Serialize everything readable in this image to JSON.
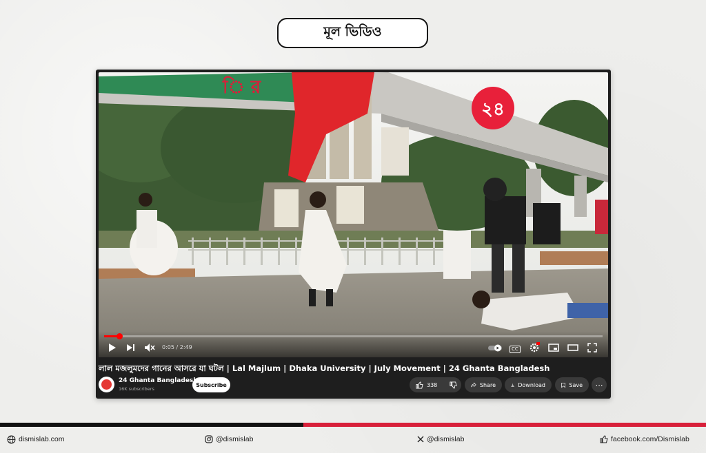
{
  "header": {
    "title": "মূল ভিডিও"
  },
  "player": {
    "logo_badge": "২৪",
    "progress": 0.03,
    "time": "0:05 / 2:49",
    "video_title": "লাল মজলুমদের গানের আসরে যা ঘটল | Lal Majlum | Dhaka University | July Movement | 24 Ghanta Bangladesh",
    "channel_name": "24 Ghanta Bangladesh",
    "channel_subs": "16K subscribers",
    "subscribe_label": "Subscribe",
    "likes": "338",
    "share_label": "Share",
    "download_label": "Download",
    "save_label": "Save",
    "more_label": "⋯",
    "cc_label": "CC",
    "accent_color": "#ff0000"
  },
  "footer": {
    "website": "dismislab.com",
    "instagram": "@dismislab",
    "x": "@dismislab",
    "facebook": "facebook.com/Dismislab"
  }
}
